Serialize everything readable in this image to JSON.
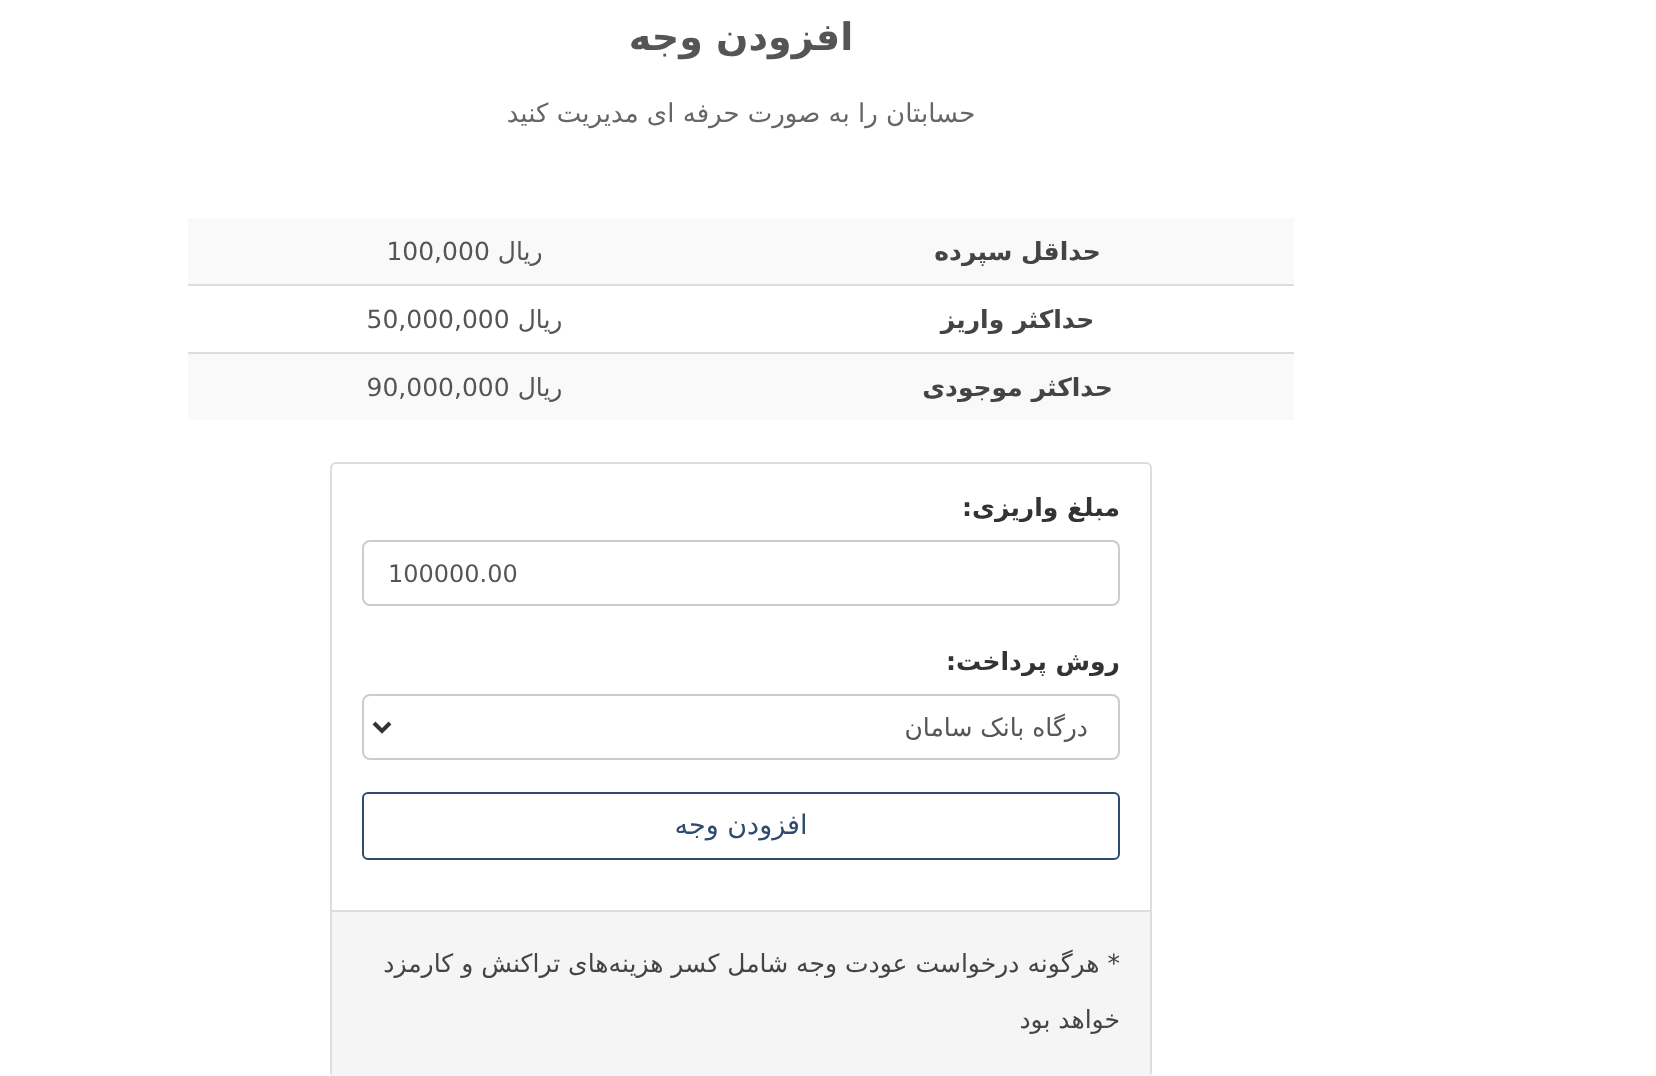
{
  "header": {
    "title": "افزودن وجه",
    "subtitle": "حسابتان را به صورت حرفه ای مدیریت کنید"
  },
  "limits": [
    {
      "label": "حداقل سپرده",
      "value": "ریال 100,000"
    },
    {
      "label": "حداکثر واریز",
      "value": "ریال 50,000,000"
    },
    {
      "label": "حداکثر موجودی",
      "value": "ریال 90,000,000"
    }
  ],
  "form": {
    "amount_label": "مبلغ واریزی:",
    "amount_value": "100000.00",
    "method_label": "روش پرداخت:",
    "method_value": "درگاه بانک سامان",
    "submit": "افزودن وجه",
    "note": "* هرگونه درخواست عودت وجه شامل کسر هزینه‌های تراکنش و کارمزد خواهد بود"
  }
}
